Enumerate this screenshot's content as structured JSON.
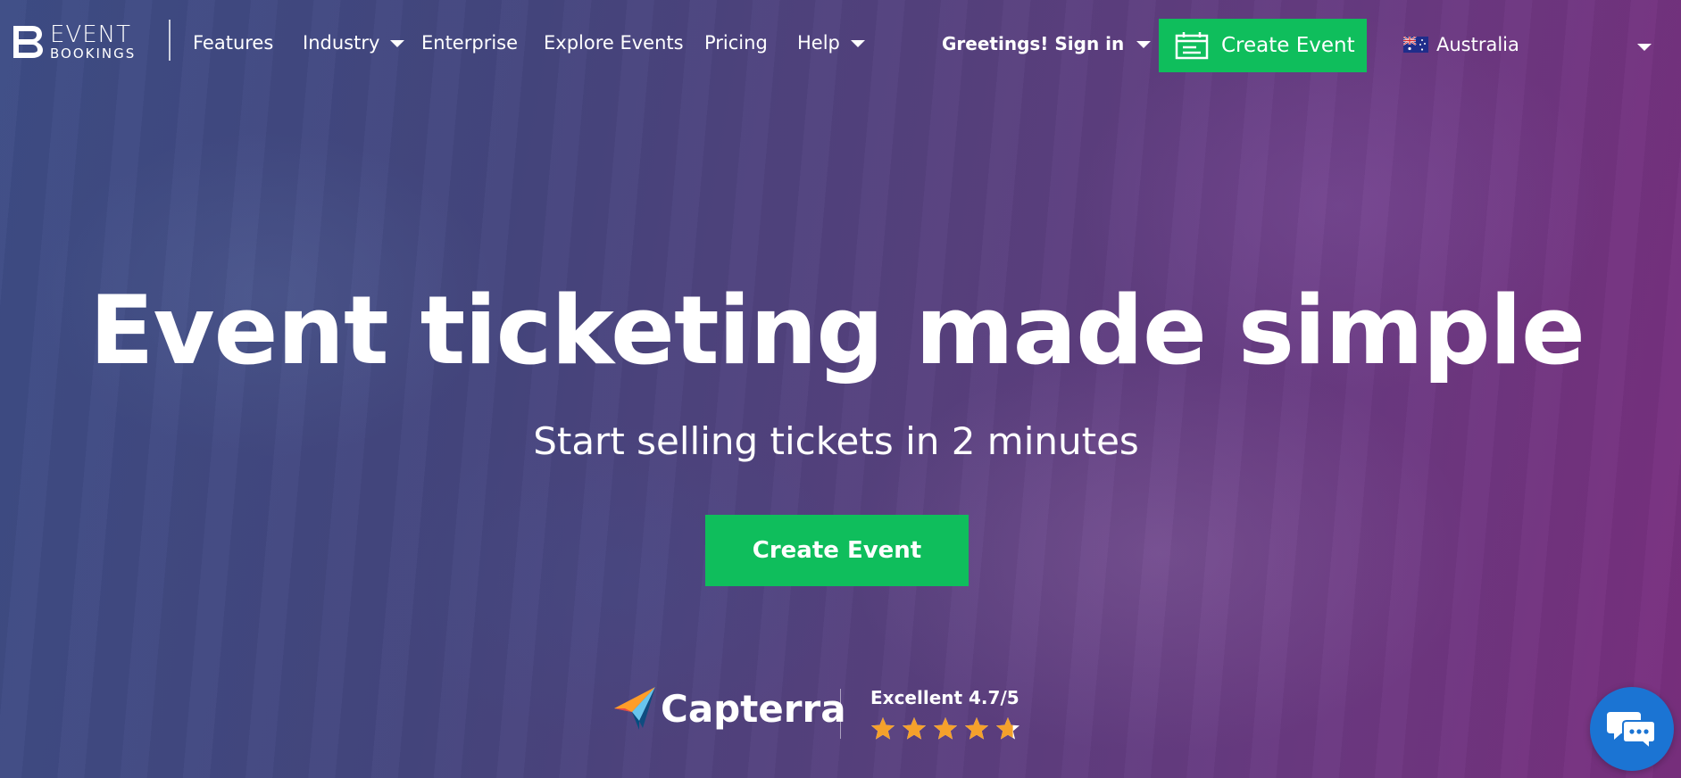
{
  "brand": {
    "line1": "EVENT",
    "line2": "BOOKINGS",
    "icon": "eb-logo-icon"
  },
  "nav": {
    "items": [
      {
        "label": "Features",
        "has_dropdown": false
      },
      {
        "label": "Industry",
        "has_dropdown": true
      },
      {
        "label": "Enterprise",
        "has_dropdown": false
      },
      {
        "label": "Explore Events",
        "has_dropdown": false
      },
      {
        "label": "Pricing",
        "has_dropdown": false
      },
      {
        "label": "Help",
        "has_dropdown": true
      }
    ],
    "signin_label": "Greetings! Sign in",
    "create_event_label": "Create Event",
    "create_event_icon": "calendar-icon",
    "country": "Australia",
    "country_flag": "australia-flag-icon"
  },
  "hero": {
    "title": "Event ticketing made simple",
    "subtitle": "Start selling tickets in 2 minutes",
    "cta_label": "Create Event"
  },
  "review": {
    "brand": "Capterra",
    "rating_text": "Excellent 4.7/5",
    "rating_value": 4.7,
    "rating_max": 5,
    "star_icon": "star-icon"
  },
  "chat": {
    "icon": "chat-bubbles-icon"
  },
  "colors": {
    "accent_green": "#0fbe5c",
    "star_orange": "#f5a12b",
    "chat_blue": "#1b74d3",
    "text": "#ffffff"
  }
}
